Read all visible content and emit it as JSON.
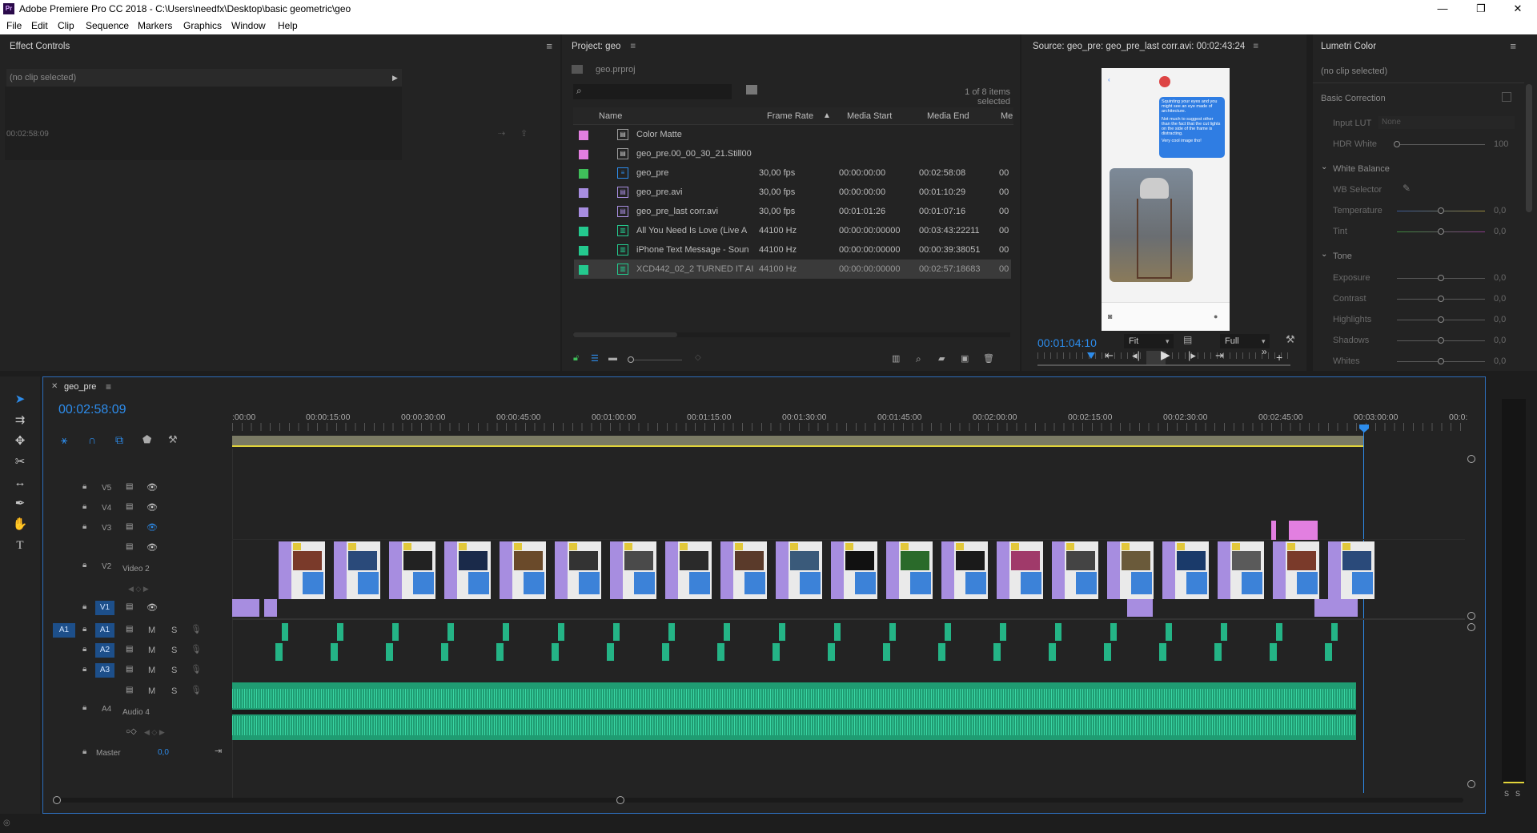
{
  "titlebar": {
    "title": "Adobe Premiere Pro CC 2018 - C:\\Users\\needfx\\Desktop\\basic geometric\\geo",
    "min": "—",
    "max": "❐",
    "close": "✕"
  },
  "menu": [
    "File",
    "Edit",
    "Clip",
    "Sequence",
    "Markers",
    "Graphics",
    "Window",
    "Help"
  ],
  "effect_controls": {
    "title": "Effect Controls",
    "clip": "(no clip selected)",
    "timecode": "00:02:58:09"
  },
  "project": {
    "title": "Project: geo",
    "file": "geo.prproj",
    "selected": "1 of 8 items selected",
    "columns": [
      "Name",
      "Frame Rate",
      "Media Start",
      "Media End",
      "Me"
    ],
    "rows": [
      {
        "color": "#e27fe0",
        "icon": "▤",
        "name": "Color Matte",
        "rate": "",
        "start": "",
        "end": "",
        "more": ""
      },
      {
        "color": "#e27fe0",
        "icon": "▤",
        "name": "geo_pre.00_00_30_21.Still00",
        "rate": "",
        "start": "",
        "end": "",
        "more": ""
      },
      {
        "color": "#3fbf5a",
        "icon": "≡",
        "name": "geo_pre",
        "rate": "30,00 fps",
        "start": "00:00:00:00",
        "end": "00:02:58:08",
        "more": "00"
      },
      {
        "color": "#a78de0",
        "icon": "▤",
        "name": "geo_pre.avi",
        "rate": "30,00 fps",
        "start": "00:00:00:00",
        "end": "00:01:10:29",
        "more": "00"
      },
      {
        "color": "#a78de0",
        "icon": "▤",
        "name": "geo_pre_last corr.avi",
        "rate": "30,00 fps",
        "start": "00:01:01:26",
        "end": "00:01:07:16",
        "more": "00"
      },
      {
        "color": "#24c98e",
        "icon": "▥",
        "name": "All You Need Is Love (Live A",
        "rate": "44100 Hz",
        "start": "00:00:00:00000",
        "end": "00:03:43:22211",
        "more": "00"
      },
      {
        "color": "#24c98e",
        "icon": "▥",
        "name": "iPhone Text Message - Soun",
        "rate": "44100 Hz",
        "start": "00:00:00:00000",
        "end": "00:00:39:38051",
        "more": "00"
      },
      {
        "color": "#24c98e",
        "icon": "▥",
        "name": "XCD442_02_2 TURNED IT AI",
        "rate": "44100 Hz",
        "start": "00:00:00:00000",
        "end": "00:02:57:18683",
        "more": "00"
      }
    ]
  },
  "source": {
    "title": "Source: geo_pre: geo_pre_last corr.avi: 00:02:43:24",
    "timecode": "00:01:04:10",
    "fit": "Fit",
    "quality": "Full",
    "msg1": "Squinting your eyes and you might see an eye made of architecture.",
    "msg2": "Not much to suggest other than the fact that the cut lights on the side of the frame is distracting.",
    "msg3": "Very cool image tho!"
  },
  "lumetri": {
    "title": "Lumetri Color",
    "clip": "(no clip selected)",
    "basic": "Basic Correction",
    "input_lut": "Input LUT",
    "lut_val": "None",
    "hdr": "HDR White",
    "hdr_val": "100",
    "wb": "White Balance",
    "wb_sel": "WB Selector",
    "temp": "Temperature",
    "tint": "Tint",
    "tone": "Tone",
    "exposure": "Exposure",
    "contrast": "Contrast",
    "highlights": "Highlights",
    "shadows": "Shadows",
    "whites": "Whites",
    "zero": "0,0"
  },
  "timeline": {
    "tab": "geo_pre",
    "timecode": "00:02:58:09",
    "ruler": [
      ":00:00",
      "00:00:15:00",
      "00:00:30:00",
      "00:00:45:00",
      "00:01:00:00",
      "00:01:15:00",
      "00:01:30:00",
      "00:01:45:00",
      "00:02:00:00",
      "00:02:15:00",
      "00:02:30:00",
      "00:02:45:00",
      "00:03:00:00",
      "00:0:"
    ],
    "tracks": {
      "v5": "V5",
      "v4": "V4",
      "v3": "V3",
      "v2": "V2",
      "v2name": "Video 2",
      "v1": "V1",
      "a1": "A1",
      "a2": "A2",
      "a3": "A3",
      "a4": "A4",
      "a4name": "Audio 4",
      "master": "Master",
      "master_val": "0,0",
      "src_a1": "A1",
      "src_v1": "V1",
      "m": "M",
      "s": "S"
    },
    "meter_s": "S"
  }
}
